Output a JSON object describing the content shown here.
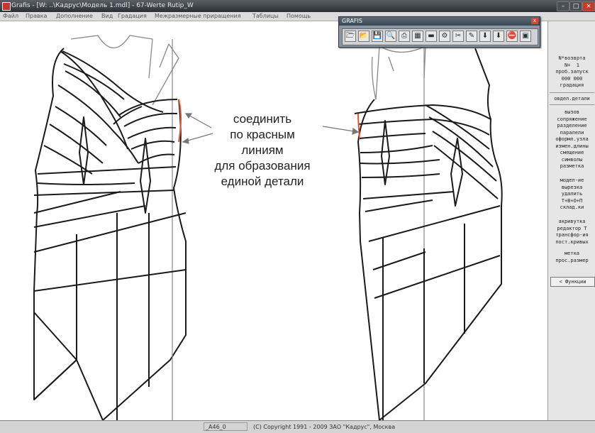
{
  "window": {
    "title": "Grafis - [W: ..\\Кадрус\\Модель 1.mdl] - 67-Werte Rutip_W",
    "buttons": {
      "minimize": "–",
      "maximize": "□",
      "close": "×"
    }
  },
  "menu": [
    "Файл",
    "Правка",
    "Дополнение",
    "Вид",
    "Градация",
    "Межразмерные приращения",
    "Таблицы",
    "Помощь"
  ],
  "toolbar": {
    "title": "GRAFIS",
    "close_label": "x",
    "buttons": [
      {
        "name": "open-folder-icon",
        "glyph": "🗁"
      },
      {
        "name": "open-model-icon",
        "glyph": "📂"
      },
      {
        "name": "save-icon",
        "glyph": "💾"
      },
      {
        "name": "zoom-icon",
        "glyph": "🔍"
      },
      {
        "name": "print-icon",
        "glyph": "⎙"
      },
      {
        "name": "table-icon",
        "glyph": "▦"
      },
      {
        "name": "measure-icon",
        "glyph": "▬"
      },
      {
        "name": "gear-icon",
        "glyph": "⚙"
      },
      {
        "name": "tools-icon",
        "glyph": "✂"
      },
      {
        "name": "edit-icon",
        "glyph": "✎"
      },
      {
        "name": "download-icon",
        "glyph": "⬇"
      },
      {
        "name": "export-icon",
        "glyph": "⬇"
      },
      {
        "name": "stop-icon",
        "glyph": "⛔"
      },
      {
        "name": "screen-icon",
        "glyph": "▣"
      }
    ]
  },
  "annotation": [
    "соединить",
    "по красным",
    "линиям",
    "для образования",
    "единой детали"
  ],
  "sidebar": {
    "top_block": "N*возврта\nN=  1\nпроб.запуск\n000 000\nградация",
    "detail_label": "овдел.детали",
    "group1": "вызов\nсопряжение\nразделение\nпаралели\nоформл.узла\nизмен.длины\nсмещение\nсимволы\nразметка",
    "group2": "модел-ие\nвырезка\nудалить\nТ+В+О+П\nсклад.ки",
    "group3": "акривутка\nредактор Т\nтрансфор-ия\nпост.кривых",
    "group4": "метка\nпрос.размер",
    "functions_button": "< Функции"
  },
  "status": {
    "cell": "_A46_0",
    "copyright": "(C) Copyright 1991 - 2009 ЗАО \"Кадрус\", Москва"
  },
  "colors": {
    "outline": "#1a1a1a",
    "guide": "#888888",
    "highlight": "#e0542e"
  }
}
